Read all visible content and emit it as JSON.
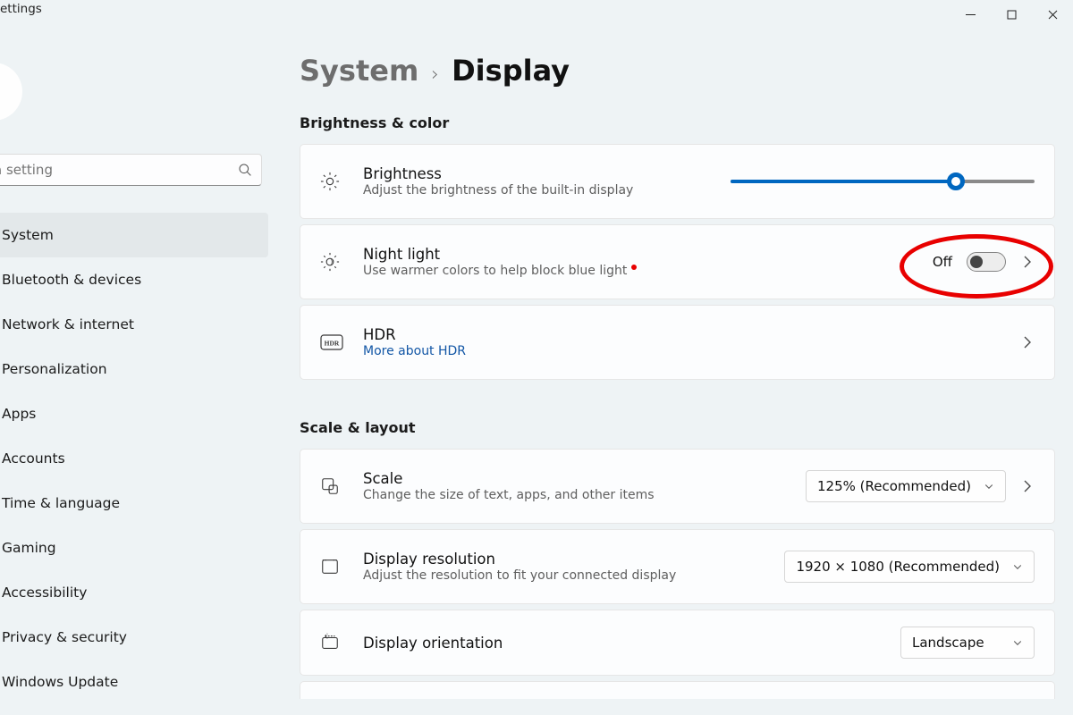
{
  "window": {
    "title": "ettings"
  },
  "search": {
    "placeholder": "a setting"
  },
  "nav": {
    "items": [
      {
        "label": "System"
      },
      {
        "label": "Bluetooth & devices"
      },
      {
        "label": "Network & internet"
      },
      {
        "label": "Personalization"
      },
      {
        "label": "Apps"
      },
      {
        "label": "Accounts"
      },
      {
        "label": "Time & language"
      },
      {
        "label": "Gaming"
      },
      {
        "label": "Accessibility"
      },
      {
        "label": "Privacy & security"
      },
      {
        "label": "Windows Update"
      }
    ],
    "selected": 0
  },
  "breadcrumb": {
    "parent": "System",
    "current": "Display"
  },
  "sections": {
    "brightness_color": {
      "header": "Brightness & color",
      "brightness": {
        "title": "Brightness",
        "subtitle": "Adjust the brightness of the built-in display",
        "value_percent": 74
      },
      "nightlight": {
        "title": "Night light",
        "subtitle": "Use warmer colors to help block blue light",
        "state_label": "Off",
        "on": false
      },
      "hdr": {
        "title": "HDR",
        "link_text": "More about HDR"
      }
    },
    "scale_layout": {
      "header": "Scale & layout",
      "scale": {
        "title": "Scale",
        "subtitle": "Change the size of text, apps, and other items",
        "value": "125% (Recommended)"
      },
      "resolution": {
        "title": "Display resolution",
        "subtitle": "Adjust the resolution to fit your connected display",
        "value": "1920 × 1080 (Recommended)"
      },
      "orientation": {
        "title": "Display orientation",
        "value": "Landscape"
      }
    }
  }
}
